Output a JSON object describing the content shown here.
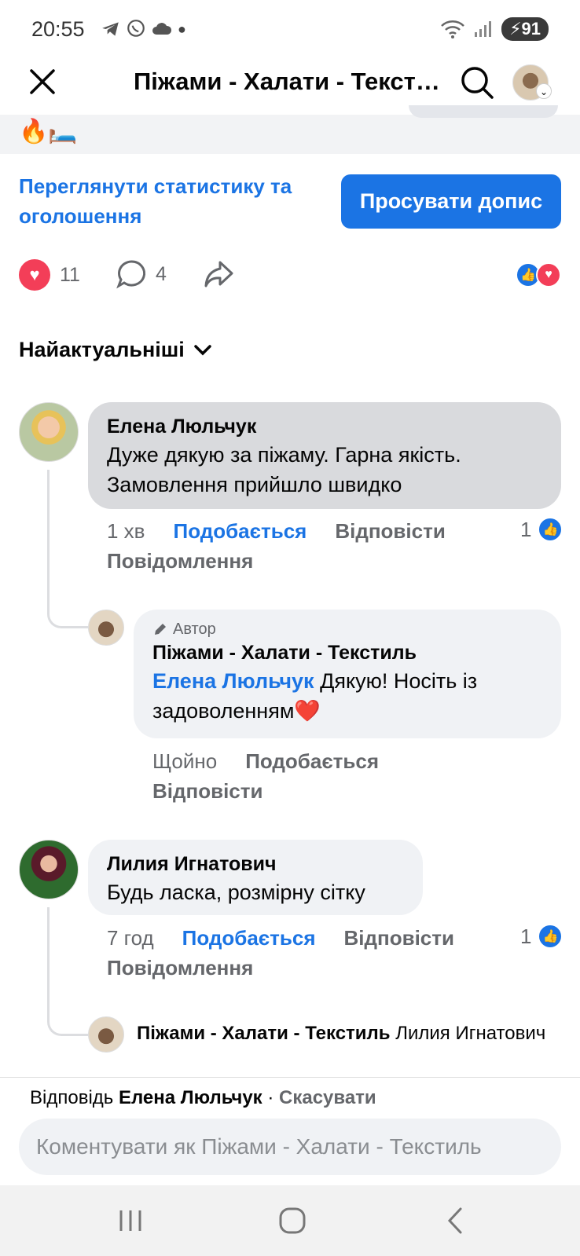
{
  "status_bar": {
    "time": "20:55",
    "battery": "91"
  },
  "header": {
    "title": "Піжами - Халати - Текстиль"
  },
  "post": {
    "emoji": "🔥🛏️",
    "stats_link": "Переглянути статистику та оголошення",
    "boost_button": "Просувати допис",
    "reactions_count": "11",
    "comments_count": "4"
  },
  "sort": {
    "label": "Найактуальніші"
  },
  "comments": [
    {
      "author": "Елена Люльчук",
      "text": "Дуже дякую за піжаму. Гарна якість. Замовлення прийшло швидко",
      "time": "1 хв",
      "like_label": "Подобається",
      "reply_label": "Відповісти",
      "message_label": "Повідомлення",
      "likes": "1",
      "reply": {
        "author_tag": "Автор",
        "author": "Піжами - Халати - Текстиль",
        "mention": "Елена Люльчук",
        "text": " Дякую! Носіть із задоволенням❤️",
        "time": "Щойно",
        "like_label": "Подобається",
        "reply_label": "Відповісти"
      }
    },
    {
      "author": "Лилия Игнатович",
      "text": "Будь ласка, розмірну сітку",
      "time": "7 год",
      "like_label": "Подобається",
      "reply_label": "Відповісти",
      "message_label": "Повідомлення",
      "likes": "1",
      "reply_preview": {
        "author": "Піжами - Халати - Текстиль",
        "text": " Лилия Игнатович"
      }
    }
  ],
  "composer": {
    "replying_prefix": "Відповідь",
    "replying_to": "Елена Люльчук",
    "separator": " · ",
    "cancel": "Скасувати",
    "placeholder": "Коментувати як Піжами - Халати - Текстиль"
  }
}
